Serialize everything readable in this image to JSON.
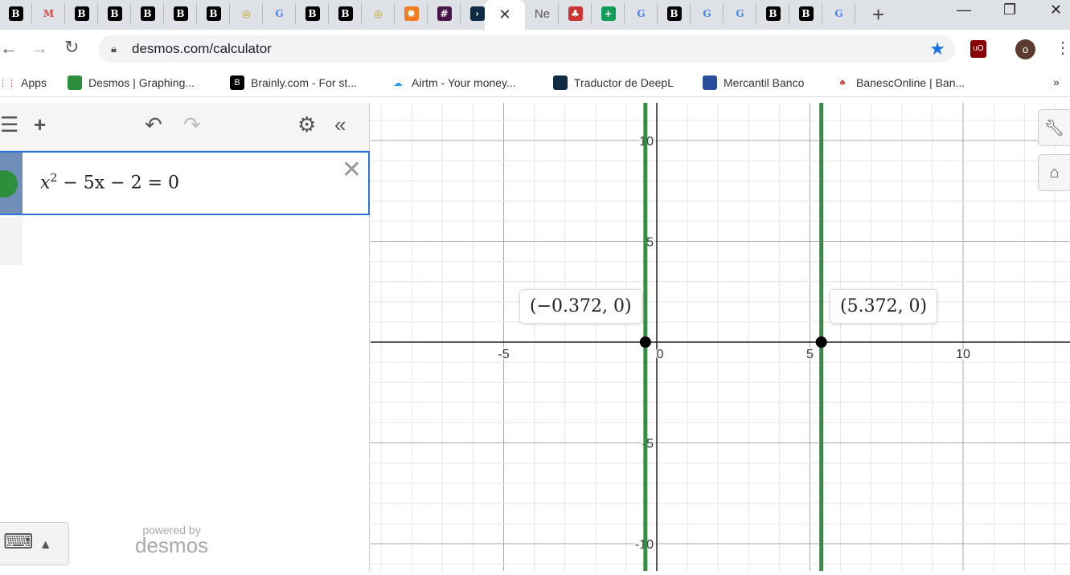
{
  "browser": {
    "tabs": [
      {
        "icon": "brainly-icon",
        "label": "B",
        "color": "#000"
      },
      {
        "icon": "gmail-icon",
        "label": "M",
        "color": "#d44"
      },
      {
        "icon": "brainly-icon",
        "label": "B",
        "color": "#000"
      },
      {
        "icon": "brainly-icon",
        "label": "B",
        "color": "#000"
      },
      {
        "icon": "brainly-icon",
        "label": "B",
        "color": "#000"
      },
      {
        "icon": "brainly-icon",
        "label": "B",
        "color": "#000"
      },
      {
        "icon": "brainly-icon",
        "label": "B",
        "color": "#000"
      },
      {
        "icon": "mercadolibre-icon",
        "label": "◎",
        "color": "#f5d742"
      },
      {
        "icon": "google-icon",
        "label": "G",
        "color": "#4285f4"
      },
      {
        "icon": "brainly-icon",
        "label": "B",
        "color": "#000"
      },
      {
        "icon": "brainly-icon",
        "label": "B",
        "color": "#000"
      },
      {
        "icon": "mercadolibre-icon",
        "label": "◎",
        "color": "#f5d742"
      },
      {
        "icon": "sun-icon",
        "label": "✹",
        "color": "#f47b20"
      },
      {
        "icon": "slack-icon",
        "label": "#",
        "color": "#4a154b"
      },
      {
        "icon": "deepl-icon",
        "label": "›",
        "color": "#0f2b46"
      }
    ],
    "active_tab_close": "✕",
    "tabs_after": [
      {
        "icon": "text-tab",
        "label": "Ne",
        "color": "#dee1e6"
      },
      {
        "icon": "banesco-icon",
        "label": "♣",
        "color": "#c33"
      },
      {
        "icon": "sheets-icon",
        "label": "+",
        "color": "#0f9d58"
      },
      {
        "icon": "google-icon",
        "label": "G",
        "color": "#4285f4"
      },
      {
        "icon": "brainly-icon",
        "label": "B",
        "color": "#000"
      },
      {
        "icon": "google-icon",
        "label": "G",
        "color": "#4285f4"
      },
      {
        "icon": "google-icon",
        "label": "G",
        "color": "#4285f4"
      },
      {
        "icon": "brainly-icon",
        "label": "B",
        "color": "#000"
      },
      {
        "icon": "brainly-icon",
        "label": "B",
        "color": "#000"
      },
      {
        "icon": "google-icon",
        "label": "G",
        "color": "#4285f4"
      }
    ],
    "new_tab": "+",
    "url": "desmos.com/calculator",
    "profile_initial": "o",
    "bookmarks": [
      {
        "label": "Apps",
        "icon": "apps-icon"
      },
      {
        "label": "Desmos | Graphing...",
        "icon": "desmos-icon"
      },
      {
        "label": "Brainly.com - For st...",
        "icon": "brainly-icon"
      },
      {
        "label": "Airtm - Your money...",
        "icon": "cloud-icon"
      },
      {
        "label": "Traductor de DeepL",
        "icon": "deepl-icon"
      },
      {
        "label": "Mercantil Banco",
        "icon": "mercantil-icon"
      },
      {
        "label": "BanescOnline | Ban...",
        "icon": "banesco-icon"
      }
    ],
    "bookmarks_more": "»"
  },
  "expression": {
    "latex_display": "x² − 5x − 2 = 0",
    "base": "x",
    "sup": "2",
    "rest": " − 5x − 2 = 0"
  },
  "branding": {
    "powered_by": "powered by",
    "logo": "desmos"
  },
  "graph": {
    "curve_color": "#388c46",
    "points": [
      {
        "x": -0.372,
        "y": 0,
        "label": "(−0.372, 0)"
      },
      {
        "x": 5.372,
        "y": 0,
        "label": "(5.372, 0)"
      }
    ],
    "x_ticks": [
      "-5",
      "0",
      "5",
      "10"
    ],
    "y_ticks": [
      "10",
      "5",
      "-5",
      "-10"
    ]
  }
}
